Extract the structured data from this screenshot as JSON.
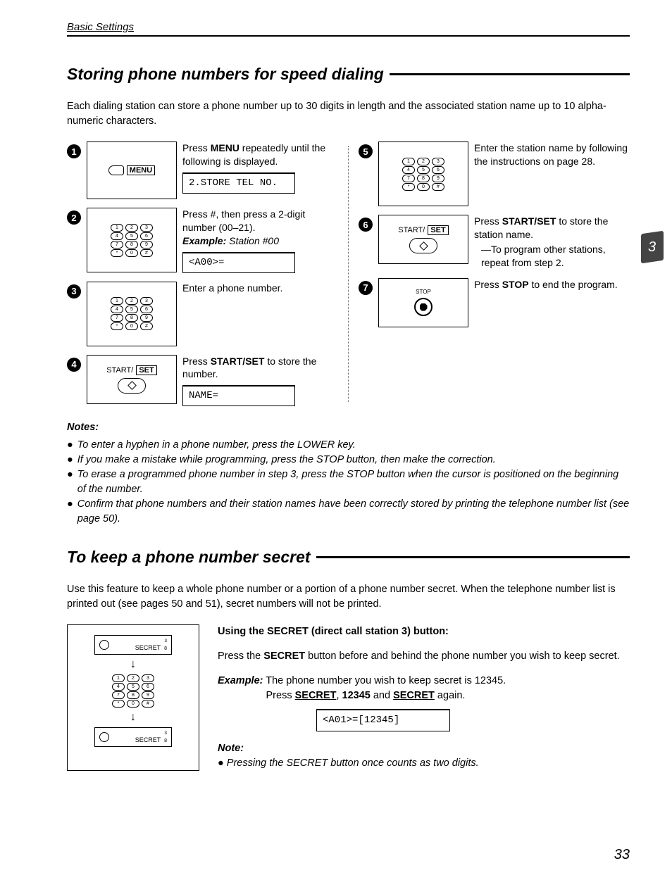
{
  "header": {
    "section": "Basic Settings"
  },
  "tab": {
    "number": "3"
  },
  "title1": "Storing phone numbers for speed dialing",
  "intro1": "Each dialing station can store a phone number up to 30 digits in length and the associated station name up to 10 alpha-numeric characters.",
  "steps": [
    {
      "num": "1",
      "illus_label": "MENU",
      "text_pre": "Press ",
      "text_bold": "MENU",
      "text_post": " repeatedly until the following is displayed.",
      "display": "2.STORE TEL NO."
    },
    {
      "num": "2",
      "text_a": "Press #, then press a 2-digit number (00–21).",
      "ex_label": "Example:",
      "ex_text": " Station #00",
      "display": "<A00>="
    },
    {
      "num": "3",
      "text": "Enter a phone number."
    },
    {
      "num": "4",
      "label1": "START/",
      "label2": "SET",
      "text_pre": "Press ",
      "text_bold": "START/SET",
      "text_post": " to store the number.",
      "display": "NAME="
    },
    {
      "num": "5",
      "text": "Enter the station name by following the instructions on page 28."
    },
    {
      "num": "6",
      "label1": "START/",
      "label2": "SET",
      "text_pre": "Press ",
      "text_bold": "START/SET",
      "text_post": " to store the station name.",
      "sub": "—To program other stations, repeat from step 2."
    },
    {
      "num": "7",
      "stop_label": "STOP",
      "text_pre": "Press ",
      "text_bold": "STOP",
      "text_post": " to end the program."
    }
  ],
  "notes": {
    "title": "Notes:",
    "items": [
      "To enter a hyphen in a phone number, press the LOWER key.",
      "If you make a mistake while programming, press the STOP button, then make the correction.",
      "To erase a programmed phone number in step 3, press the STOP button when the cursor is positioned on the beginning of the number.",
      "Confirm that phone numbers and their station names have been correctly stored by printing the telephone number list (see page 50)."
    ]
  },
  "title2": "To keep a phone number secret",
  "intro2": "Use this feature to keep a whole phone number or a portion of a phone number secret. When the telephone number list is printed out (see pages 50 and 51), secret numbers will not be printed.",
  "secret": {
    "btn_sup": "3",
    "btn_label": "SECRET",
    "btn_sub": "8",
    "subhead": "Using the SECRET (direct call station 3) button:",
    "para_pre": "Press the ",
    "para_bold": "SECRET",
    "para_post": " button before and behind the phone number you wish to keep secret.",
    "example_label": "Example:",
    "example_line1": " The phone number you wish to keep secret is 12345.",
    "example_line2_a": "Press ",
    "example_line2_b": "SECRET",
    "example_line2_c": ", ",
    "example_line2_d": "12345",
    "example_line2_e": " and ",
    "example_line2_f": "SECRET",
    "example_line2_g": " again.",
    "display": "<A01>=[12345]",
    "note_title": "Note:",
    "note_text": "Pressing the SECRET button once counts as two digits."
  },
  "page_number": "33"
}
